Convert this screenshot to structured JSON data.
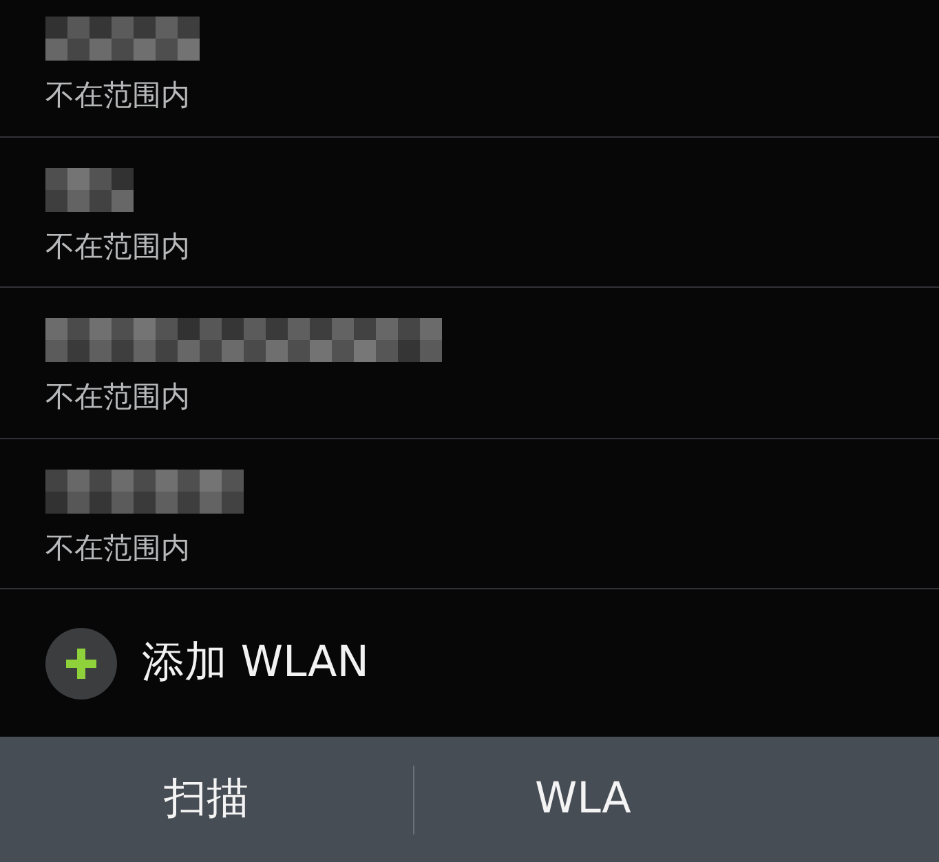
{
  "networks": [
    {
      "status": "不在范围内"
    },
    {
      "status": "不在范围内"
    },
    {
      "status": "不在范围内"
    },
    {
      "status": "不在范围内"
    }
  ],
  "add_network": {
    "label": "添加 WLAN"
  },
  "bottom_bar": {
    "buttons": [
      {
        "label": "扫描"
      },
      {
        "label": "WLA"
      }
    ]
  }
}
